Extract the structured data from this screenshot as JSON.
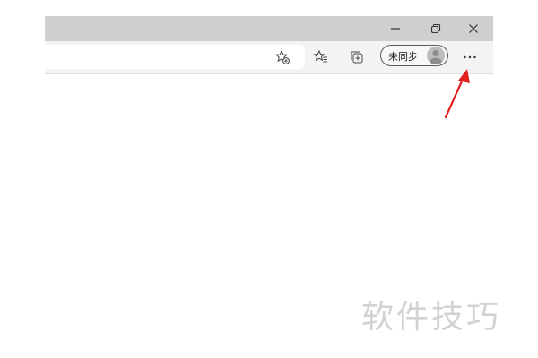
{
  "window": {
    "minimize_icon": "minimize-icon",
    "restore_icon": "restore-icon",
    "close_icon": "close-icon"
  },
  "toolbar": {
    "favorite_add_icon": "add-favorite-icon",
    "favorites_icon": "favorites-icon",
    "collections_icon": "collections-icon",
    "profile": {
      "sync_label": "未同步",
      "avatar_icon": "user-avatar-icon"
    },
    "more_icon": "more-menu-icon"
  },
  "annotation": {
    "arrow_color": "#e02020",
    "target": "more-menu-button"
  },
  "watermark": {
    "text": "软件技巧"
  },
  "colors": {
    "titlebar": "#cfcfcf",
    "toolbar": "#f3f3f3",
    "page": "#ffffff",
    "watermark": "#d2d2d2"
  }
}
